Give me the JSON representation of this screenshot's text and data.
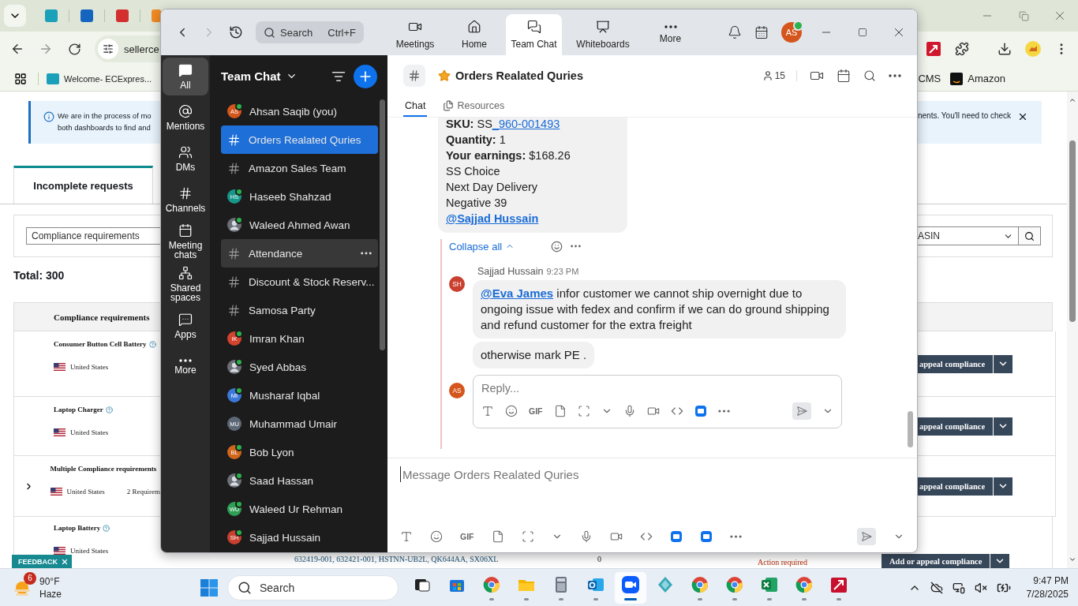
{
  "browser": {
    "address": "sellerce",
    "bookmarks": [
      {
        "label": "Welcome- ECExpres..."
      }
    ],
    "bookmarks_right": [
      {
        "label": "CMS",
        "kind": "plain"
      },
      {
        "label": "Amazon",
        "kind": "amazon"
      }
    ],
    "banner": {
      "left_lines": [
        "We are in the process of mo",
        "both dashboards to find and"
      ],
      "right_text": "nents. You'll need to check"
    },
    "tabs": [
      {
        "label": "Incomplete requests",
        "selected": true
      }
    ],
    "filter": {
      "left_value": "Compliance requirements",
      "right_value": "ASIN"
    },
    "total": "Total: 300",
    "table": {
      "header": "Compliance requirements",
      "rows": [
        {
          "title": "Consumer Button Cell Battery",
          "help": true,
          "expandable": false,
          "country": "United States",
          "action": "appeal compliance"
        },
        {
          "title": "Laptop Charger",
          "help": true,
          "expandable": false,
          "country": "United States",
          "action": "appeal compliance"
        },
        {
          "title": "Multiple Compliance requirements",
          "help": false,
          "expandable": true,
          "country": "United States",
          "extra": "2 Requirem",
          "action": "appeal compliance"
        },
        {
          "title": "Laptop Battery",
          "help": true,
          "expandable": false,
          "country": "United States",
          "action": "Add or appeal compliance",
          "parts": "632419-001, 632421-001, HSTNN-UB2L, QK644AA, SX06XL",
          "count": "0",
          "status": "Action required"
        }
      ]
    },
    "feedback": "FEEDBACK"
  },
  "zoom": {
    "search": {
      "placeholder": "Search",
      "shortcut": "Ctrl+F"
    },
    "nav": [
      {
        "label": "Meetings",
        "kind": "meetings",
        "selected": false
      },
      {
        "label": "Home",
        "kind": "home",
        "selected": false
      },
      {
        "label": "Team Chat",
        "kind": "chat",
        "selected": true
      },
      {
        "label": "Whiteboards",
        "kind": "whiteboards",
        "selected": false
      },
      {
        "label": "More",
        "kind": "more",
        "selected": false
      }
    ],
    "avatar": {
      "initials": "AS",
      "online": true
    },
    "rail": [
      {
        "label": "All",
        "kind": "all",
        "selected": true
      },
      {
        "label": "Mentions",
        "kind": "mentions",
        "selected": false
      },
      {
        "label": "DMs",
        "kind": "dms",
        "selected": false
      },
      {
        "label": "Channels",
        "kind": "channels",
        "selected": false
      },
      {
        "label": "Meeting chats",
        "kind": "meetings",
        "selected": false
      },
      {
        "label": "Shared spaces",
        "kind": "shared",
        "selected": false
      },
      {
        "label": "Apps",
        "kind": "apps",
        "selected": false
      },
      {
        "label": "More",
        "kind": "more",
        "selected": false
      }
    ],
    "list_title": "Team Chat",
    "list": [
      {
        "kind": "person",
        "name": "Ahsan Saqib (you)",
        "initials": "AS",
        "color": "#d4561c",
        "online": true,
        "selected": false,
        "hovered": false
      },
      {
        "kind": "channel",
        "name": "Orders Realated Quries",
        "selected": true,
        "hovered": false
      },
      {
        "kind": "channel",
        "name": "Amazon Sales Team",
        "selected": false,
        "hovered": false
      },
      {
        "kind": "person",
        "name": "Haseeb Shahzad",
        "initials": "HS",
        "color": "#17978a",
        "online": true,
        "selected": false,
        "hovered": false
      },
      {
        "kind": "photo",
        "name": "Waleed Ahmed Awan",
        "online": true,
        "selected": false,
        "hovered": false
      },
      {
        "kind": "channel",
        "name": "Attendance",
        "selected": false,
        "hovered": true
      },
      {
        "kind": "channel",
        "name": "Discount & Stock Reserv...",
        "selected": false,
        "hovered": false
      },
      {
        "kind": "channel",
        "name": "Samosa Party",
        "selected": false,
        "hovered": false
      },
      {
        "kind": "person",
        "name": "Imran Khan",
        "initials": "IK",
        "color": "#d3432e",
        "online": true,
        "selected": false,
        "hovered": false
      },
      {
        "kind": "photo",
        "name": "Syed Abbas",
        "online": true,
        "selected": false,
        "hovered": false
      },
      {
        "kind": "person",
        "name": "Musharaf Iqbal",
        "initials": "MI",
        "color": "#3b78d8",
        "online": true,
        "selected": false,
        "hovered": false
      },
      {
        "kind": "person",
        "name": "Muhammad Umair",
        "initials": "MU",
        "color": "#5d6876",
        "online": false,
        "selected": false,
        "hovered": false
      },
      {
        "kind": "person",
        "name": "Bob Lyon",
        "initials": "BL",
        "color": "#d0651c",
        "online": true,
        "selected": false,
        "hovered": false
      },
      {
        "kind": "photo",
        "name": "Saad Hassan",
        "online": true,
        "selected": false,
        "hovered": false
      },
      {
        "kind": "person",
        "name": "Waleed Ur Rehman",
        "initials": "WU",
        "color": "#2f9e55",
        "online": true,
        "selected": false,
        "hovered": false
      },
      {
        "kind": "person",
        "name": "Sajjad Hussain",
        "initials": "SH",
        "color": "#c9402f",
        "online": true,
        "selected": false,
        "hovered": false
      }
    ],
    "channel": {
      "title": "Orders Realated Quries",
      "starred": true,
      "members": "15",
      "tabs": [
        {
          "label": "Chat",
          "kind": "chat",
          "selected": true
        },
        {
          "label": "Resources",
          "kind": "resources",
          "selected": false
        }
      ],
      "card_lines": [
        {
          "kind": "field",
          "text": "**SKU:** SS",
          "link": "_960-001493"
        },
        {
          "kind": "field",
          "text": "**Quantity:** 1"
        },
        {
          "kind": "field",
          "text": "**Your earnings:** $168.26"
        },
        {
          "kind": "plain",
          "text": "SS Choice"
        },
        {
          "kind": "plain",
          "text": "Next Day Delivery"
        },
        {
          "kind": "plain",
          "text": "Negative 39"
        },
        {
          "kind": "mention",
          "text": "@Sajjad Hussain"
        }
      ],
      "collapse": "Collapse all",
      "reply": {
        "author": "Sajjad Hussain",
        "time": "9:23 PM",
        "initials": "SH",
        "color": "#c9402f",
        "bubbles": [
          {
            "mention": "@Eva James",
            "text": " infor customer we cannot ship overnight due to ongoing issue with fedex and confirm if we can do ground shipping and refund customer for the extra freight"
          },
          {
            "text": "otherwise mark PE ."
          }
        ]
      },
      "reply_box": {
        "initials": "AS",
        "color": "#d4561c",
        "placeholder": "Reply...",
        "gif": "GIF"
      },
      "composer": {
        "placeholder": "Message Orders Realated Quries",
        "gif": "GIF"
      }
    }
  },
  "taskbar": {
    "weather": {
      "badge": "6",
      "temp": "90°F",
      "condition": "Haze"
    },
    "search": "Search",
    "apps": [
      {
        "kind": "taskview",
        "running": false,
        "active": false
      },
      {
        "kind": "store",
        "running": false,
        "active": false
      },
      {
        "kind": "chrome",
        "running": true,
        "active": false
      },
      {
        "kind": "folder",
        "running": true,
        "active": false
      },
      {
        "kind": "calculator",
        "running": true,
        "active": false
      },
      {
        "kind": "outlook",
        "running": true,
        "active": false
      },
      {
        "kind": "zoom",
        "running": true,
        "active": true
      },
      {
        "kind": "diamond",
        "running": false,
        "active": false
      },
      {
        "kind": "chrome",
        "running": true,
        "active": false
      },
      {
        "kind": "chrome",
        "running": true,
        "active": false
      },
      {
        "kind": "excel",
        "running": true,
        "active": false
      },
      {
        "kind": "chrome",
        "running": true,
        "active": false
      },
      {
        "kind": "redapp",
        "running": true,
        "active": false
      }
    ],
    "time": "9:47 PM",
    "date": "7/28/2025"
  }
}
